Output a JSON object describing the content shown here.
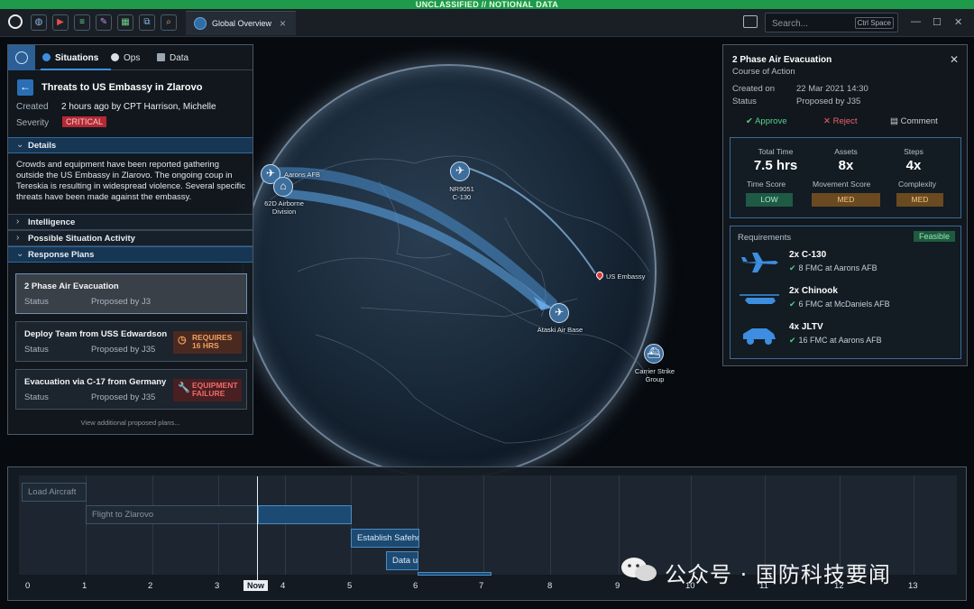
{
  "classification": "UNCLASSIFIED // NOTIONAL DATA",
  "topbar": {
    "tab_label": "Global Overview",
    "tab_close": "×",
    "search_placeholder": "Search...",
    "search_shortcut": "Ctrl Space"
  },
  "left_panel": {
    "tabs": [
      "Situations",
      "Ops",
      "Data"
    ],
    "title": "Threats to US Embassy in Zlarovo",
    "created_label": "Created",
    "created_value": "2 hours ago by CPT Harrison, Michelle",
    "severity_label": "Severity",
    "severity_value": "CRITICAL",
    "sections": {
      "details": "Details",
      "intelligence": "Intelligence",
      "activity": "Possible Situation Activity",
      "plans": "Response Plans"
    },
    "details_text": "Crowds and equipment have been reported gathering outside the US Embassy in Zlarovo. The ongoing coup in Tereskia is resulting in widespread violence. Several specific threats have been made against the embassy.",
    "plans": [
      {
        "title": "2 Phase Air Evacuation",
        "status_label": "Status",
        "status": "Proposed by J3"
      },
      {
        "title": "Deploy Team from USS Edwardson",
        "status_label": "Status",
        "status": "Proposed by J35",
        "warning": "REQUIRES 16 HRS"
      },
      {
        "title": "Evacuation via C-17 from Germany",
        "status_label": "Status",
        "status": "Proposed by J35",
        "warning": "EQUIPMENT FAILURE"
      }
    ],
    "more_link": "View additional proposed plans..."
  },
  "map_labels": {
    "aarons": "Aarons AFB",
    "airborne": "62D Airborne Division",
    "nr": "NR9051 C-130",
    "embassy": "US Embassy",
    "ataski": "Ataski Air Base",
    "carrier": "Carrier Strike Group"
  },
  "right_panel": {
    "title": "2 Phase Air Evacuation",
    "subtitle": "Course of Action",
    "created_label": "Created on",
    "created_value": "22 Mar 2021  14:30",
    "status_label": "Status",
    "status_value": "Proposed by J35",
    "actions": [
      "Approve",
      "Reject",
      "Comment"
    ],
    "stats": [
      {
        "label": "Total Time",
        "value": "7.5 hrs"
      },
      {
        "label": "Assets",
        "value": "8x"
      },
      {
        "label": "Steps",
        "value": "4x"
      }
    ],
    "scores": [
      {
        "label": "Time Score",
        "value": "LOW"
      },
      {
        "label": "Movement Score",
        "value": "MED"
      },
      {
        "label": "Complexity",
        "value": "MED"
      }
    ],
    "requirements_label": "Requirements",
    "feasible": "Feasible",
    "requirements": [
      {
        "name": "2x C-130",
        "detail": "8 FMC at Aarons AFB",
        "icon": "c130-aircraft-icon"
      },
      {
        "name": "2x Chinook",
        "detail": "6 FMC at McDaniels AFB",
        "icon": "chinook-helicopter-icon"
      },
      {
        "name": "4x JLTV",
        "detail": "16 FMC at Aarons AFB",
        "icon": "jltv-vehicle-icon"
      }
    ]
  },
  "timeline": {
    "tasks": [
      "Load Aircraft",
      "Flight to Zlarovo",
      "Establish Safehouse",
      "Data uplink"
    ],
    "ticks": [
      "0",
      "1",
      "2",
      "3",
      "4",
      "5",
      "6",
      "7",
      "8",
      "9",
      "10",
      "11",
      "12",
      "13"
    ],
    "now": "Now"
  },
  "watermark": "公众号 · 国防科技要闻"
}
